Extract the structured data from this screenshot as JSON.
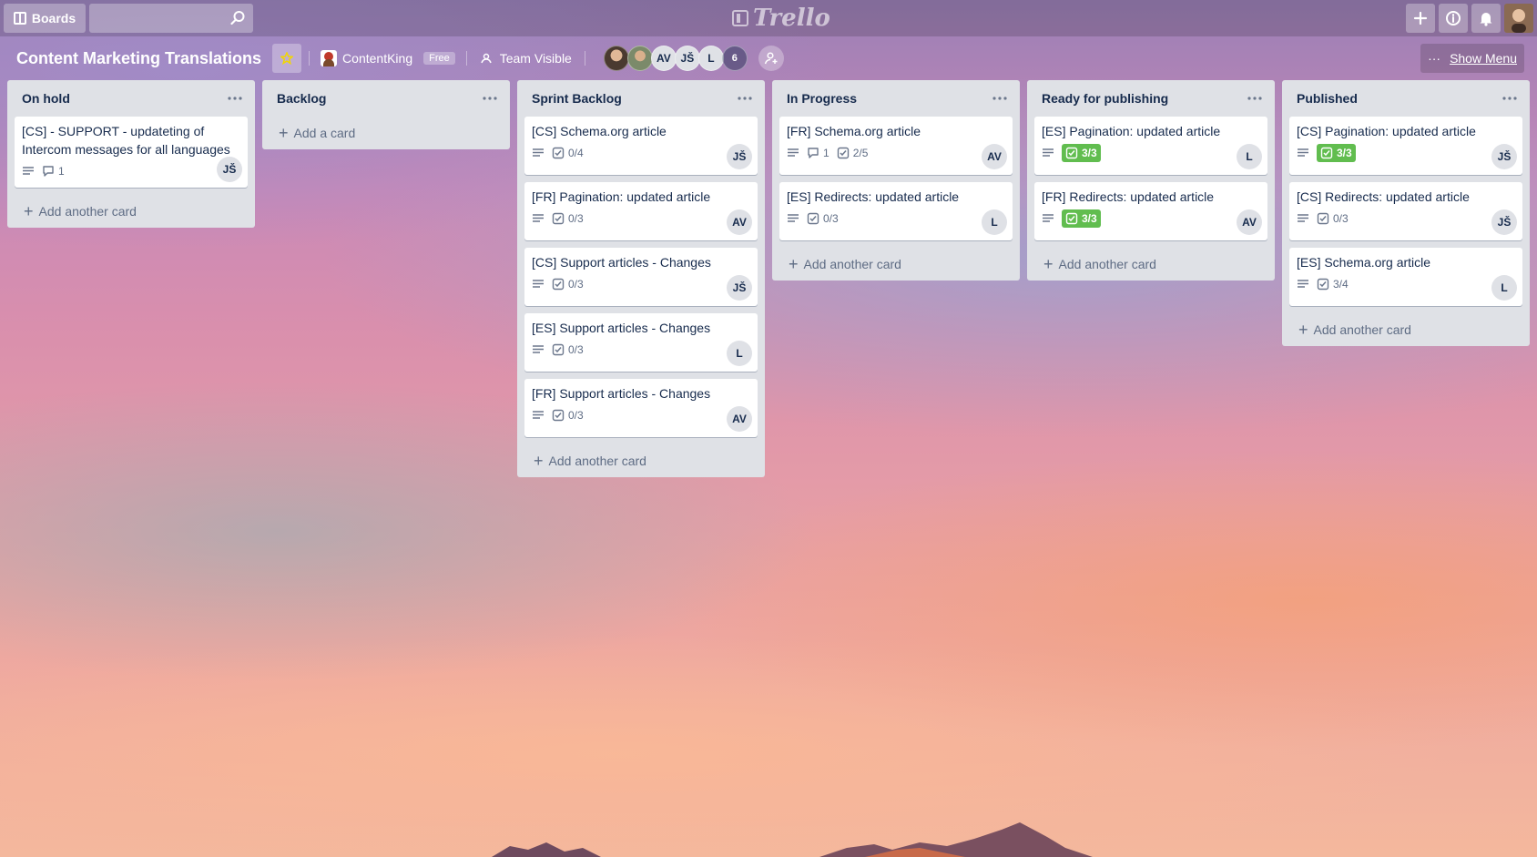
{
  "header": {
    "boards_label": "Boards",
    "search_value": "",
    "logo_text": "Trello"
  },
  "board": {
    "title": "Content Marketing Translations",
    "team_name": "ContentKing",
    "team_plan": "Free",
    "visibility": "Team Visible",
    "members": [
      "AV",
      "JŠ",
      "L"
    ],
    "member_count": "6",
    "show_menu_label": "Show Menu"
  },
  "lists": [
    {
      "title": "On hold",
      "cards": [
        {
          "title": "[CS] - SUPPORT - updateting of Intercom messages for all languages",
          "description": true,
          "comments": "1",
          "checklist": "",
          "checklist_done": false,
          "member": "JŠ"
        }
      ],
      "add_label": "Add another card"
    },
    {
      "title": "Backlog",
      "cards": [],
      "add_label": "Add a card"
    },
    {
      "title": "Sprint Backlog",
      "cards": [
        {
          "title": "[CS] Schema.org article",
          "description": true,
          "comments": "",
          "checklist": "0/4",
          "checklist_done": false,
          "member": "JŠ"
        },
        {
          "title": "[FR] Pagination: updated article",
          "description": true,
          "comments": "",
          "checklist": "0/3",
          "checklist_done": false,
          "member": "AV"
        },
        {
          "title": "[CS] Support articles - Changes",
          "description": true,
          "comments": "",
          "checklist": "0/3",
          "checklist_done": false,
          "member": "JŠ"
        },
        {
          "title": "[ES] Support articles - Changes",
          "description": true,
          "comments": "",
          "checklist": "0/3",
          "checklist_done": false,
          "member": "L"
        },
        {
          "title": "[FR] Support articles - Changes",
          "description": true,
          "comments": "",
          "checklist": "0/3",
          "checklist_done": false,
          "member": "AV"
        }
      ],
      "add_label": "Add another card"
    },
    {
      "title": "In Progress",
      "cards": [
        {
          "title": "[FR] Schema.org article",
          "description": true,
          "comments": "1",
          "checklist": "2/5",
          "checklist_done": false,
          "member": "AV"
        },
        {
          "title": "[ES] Redirects: updated article",
          "description": true,
          "comments": "",
          "checklist": "0/3",
          "checklist_done": false,
          "member": "L"
        }
      ],
      "add_label": "Add another card"
    },
    {
      "title": "Ready for publishing",
      "cards": [
        {
          "title": "[ES] Pagination: updated article",
          "description": true,
          "comments": "",
          "checklist": "3/3",
          "checklist_done": true,
          "member": "L"
        },
        {
          "title": "[FR] Redirects: updated article",
          "description": true,
          "comments": "",
          "checklist": "3/3",
          "checklist_done": true,
          "member": "AV"
        }
      ],
      "add_label": "Add another card"
    },
    {
      "title": "Published",
      "cards": [
        {
          "title": "[CS] Pagination: updated article",
          "description": true,
          "comments": "",
          "checklist": "3/3",
          "checklist_done": true,
          "member": "JŠ"
        },
        {
          "title": "[CS] Redirects: updated article",
          "description": true,
          "comments": "",
          "checklist": "0/3",
          "checklist_done": false,
          "member": "JŠ"
        },
        {
          "title": "[ES] Schema.org article",
          "description": true,
          "comments": "",
          "checklist": "3/4",
          "checklist_done": false,
          "member": "L"
        }
      ],
      "add_label": "Add another card"
    }
  ],
  "colors": {
    "list_bg": "#dfe1e6",
    "done_badge": "#61bd4f",
    "text": "#172b4d",
    "muted": "#5e6c84"
  },
  "icons": {
    "description": "description-icon",
    "comment": "comment-icon",
    "checklist": "checklist-icon",
    "menu": "ellipsis-icon",
    "star": "star-icon"
  }
}
